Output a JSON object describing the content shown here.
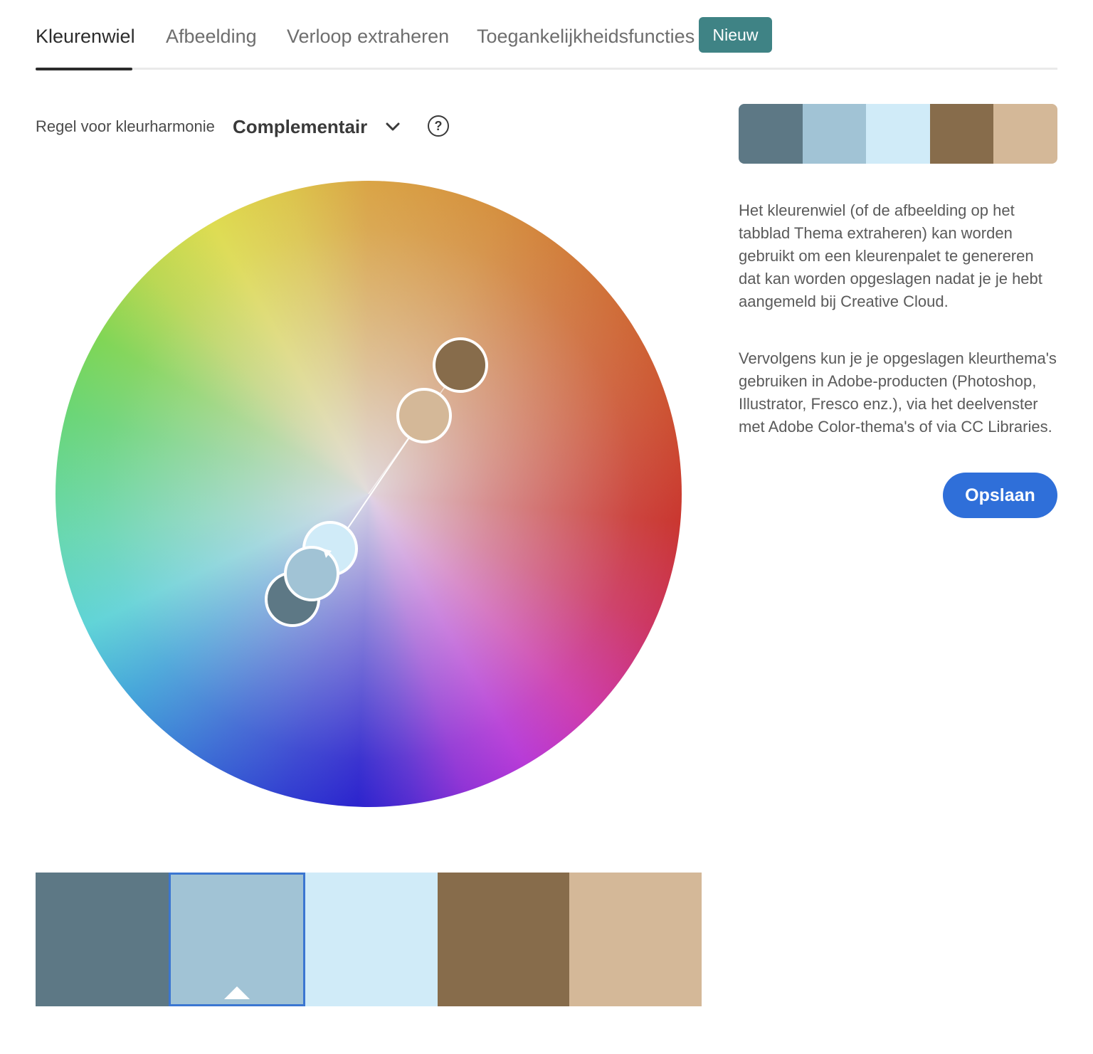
{
  "tabs": [
    {
      "label": "Kleurenwiel",
      "active": true
    },
    {
      "label": "Afbeelding",
      "active": false
    },
    {
      "label": "Verloop extraheren",
      "active": false
    },
    {
      "label": "Toegankelijkheidsfuncties",
      "active": false
    }
  ],
  "badge": "Nieuw",
  "harmony": {
    "label": "Regel voor kleurharmonie",
    "value": "Complementair",
    "help": "?"
  },
  "palette": [
    "#5d7885",
    "#a1c3d5",
    "#d0ebf8",
    "#876c4b",
    "#d4b898"
  ],
  "selected_swatch": 1,
  "description": [
    "Het kleurenwiel (of de afbeelding op het tabblad Thema extraheren) kan worden gebruikt om een kleurenpalet te genereren dat kan worden opgeslagen nadat je je hebt aangemeld bij Creative Cloud.",
    "Vervolgens kun je je opgeslagen kleurthema's gebruiken in Adobe-producten (Photoshop, Illustrator, Fresco enz.), via het deelvenster met Adobe Color-thema's of via CC Libraries."
  ],
  "save_label": "Opslaan",
  "colors": {
    "badge": "#3f8385",
    "save": "#2f6fd9",
    "selection": "#3b76d1"
  }
}
